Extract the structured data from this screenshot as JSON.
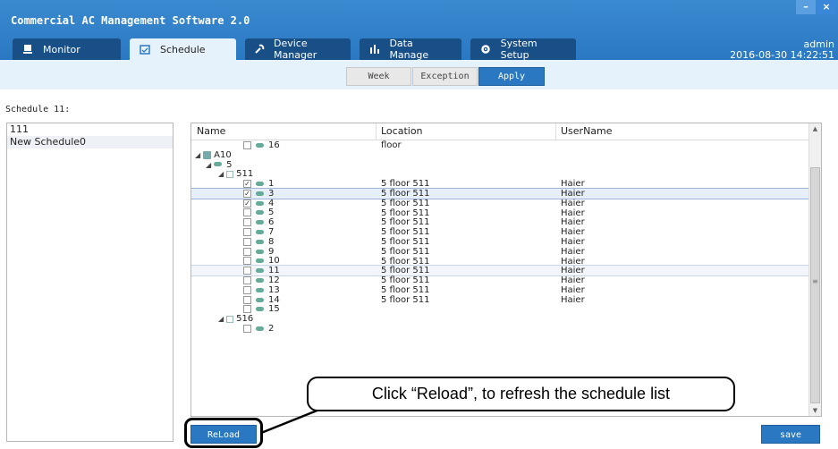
{
  "app": {
    "title": "Commercial AC Management Software 2.0",
    "minimize": "–",
    "close": "×"
  },
  "tabs": [
    {
      "label": "Monitor",
      "icon": "monitor-icon"
    },
    {
      "label": "Schedule",
      "icon": "calendar-icon"
    },
    {
      "label": "Device Manager",
      "icon": "wrench-icon"
    },
    {
      "label": "Data Manage",
      "icon": "bar-chart-icon"
    },
    {
      "label": "System Setup",
      "icon": "gear-icon"
    }
  ],
  "user": {
    "name": "admin",
    "datetime": "2016-08-30 14:22:51"
  },
  "subtabs": [
    "Week",
    "Exception",
    "Apply"
  ],
  "schedule_label": "Schedule 11:",
  "schedules": [
    "111",
    "New Schedule0"
  ],
  "columns": {
    "name": "Name",
    "location": "Location",
    "username": "UserName"
  },
  "tree": [
    {
      "kind": "unit",
      "indent": 58,
      "checked": false,
      "name": "16",
      "location": "floor",
      "user": ""
    },
    {
      "kind": "building",
      "indent": 4,
      "name": "A10"
    },
    {
      "kind": "group",
      "indent": 16,
      "name": "5"
    },
    {
      "kind": "room",
      "indent": 30,
      "name": "511"
    },
    {
      "kind": "unit",
      "indent": 58,
      "checked": true,
      "name": "1",
      "location": "5 floor 511",
      "user": "Haier"
    },
    {
      "kind": "unit",
      "indent": 58,
      "checked": true,
      "name": "3",
      "location": "5 floor 511",
      "user": "Haier",
      "state": "sel"
    },
    {
      "kind": "unit",
      "indent": 58,
      "checked": true,
      "name": "4",
      "location": "5 floor 511",
      "user": "Haier"
    },
    {
      "kind": "unit",
      "indent": 58,
      "checked": false,
      "name": "5",
      "location": "5 floor 511",
      "user": "Haier"
    },
    {
      "kind": "unit",
      "indent": 58,
      "checked": false,
      "name": "6",
      "location": "5 floor 511",
      "user": "Haier"
    },
    {
      "kind": "unit",
      "indent": 58,
      "checked": false,
      "name": "7",
      "location": "5 floor 511",
      "user": "Haier"
    },
    {
      "kind": "unit",
      "indent": 58,
      "checked": false,
      "name": "8",
      "location": "5 floor 511",
      "user": "Haier"
    },
    {
      "kind": "unit",
      "indent": 58,
      "checked": false,
      "name": "9",
      "location": "5 floor 511",
      "user": "Haier"
    },
    {
      "kind": "unit",
      "indent": 58,
      "checked": false,
      "name": "10",
      "location": "5 floor 511",
      "user": "Haier"
    },
    {
      "kind": "unit",
      "indent": 58,
      "checked": false,
      "name": "11",
      "location": "5 floor 511",
      "user": "Haier",
      "state": "hov"
    },
    {
      "kind": "unit",
      "indent": 58,
      "checked": false,
      "name": "12",
      "location": "5 floor 511",
      "user": "Haier"
    },
    {
      "kind": "unit",
      "indent": 58,
      "checked": false,
      "name": "13",
      "location": "5 floor 511",
      "user": "Haier"
    },
    {
      "kind": "unit",
      "indent": 58,
      "checked": false,
      "name": "14",
      "location": "5 floor 511",
      "user": "Haier"
    },
    {
      "kind": "unit",
      "indent": 58,
      "checked": false,
      "name": "15",
      "location": "",
      "user": ""
    },
    {
      "kind": "room",
      "indent": 30,
      "name": "516"
    },
    {
      "kind": "unit",
      "indent": 58,
      "checked": false,
      "name": "2",
      "location": "",
      "user": ""
    }
  ],
  "buttons": {
    "reload": "ReLoad",
    "save": "save"
  },
  "callout": "Click “Reload”, to refresh the schedule list"
}
